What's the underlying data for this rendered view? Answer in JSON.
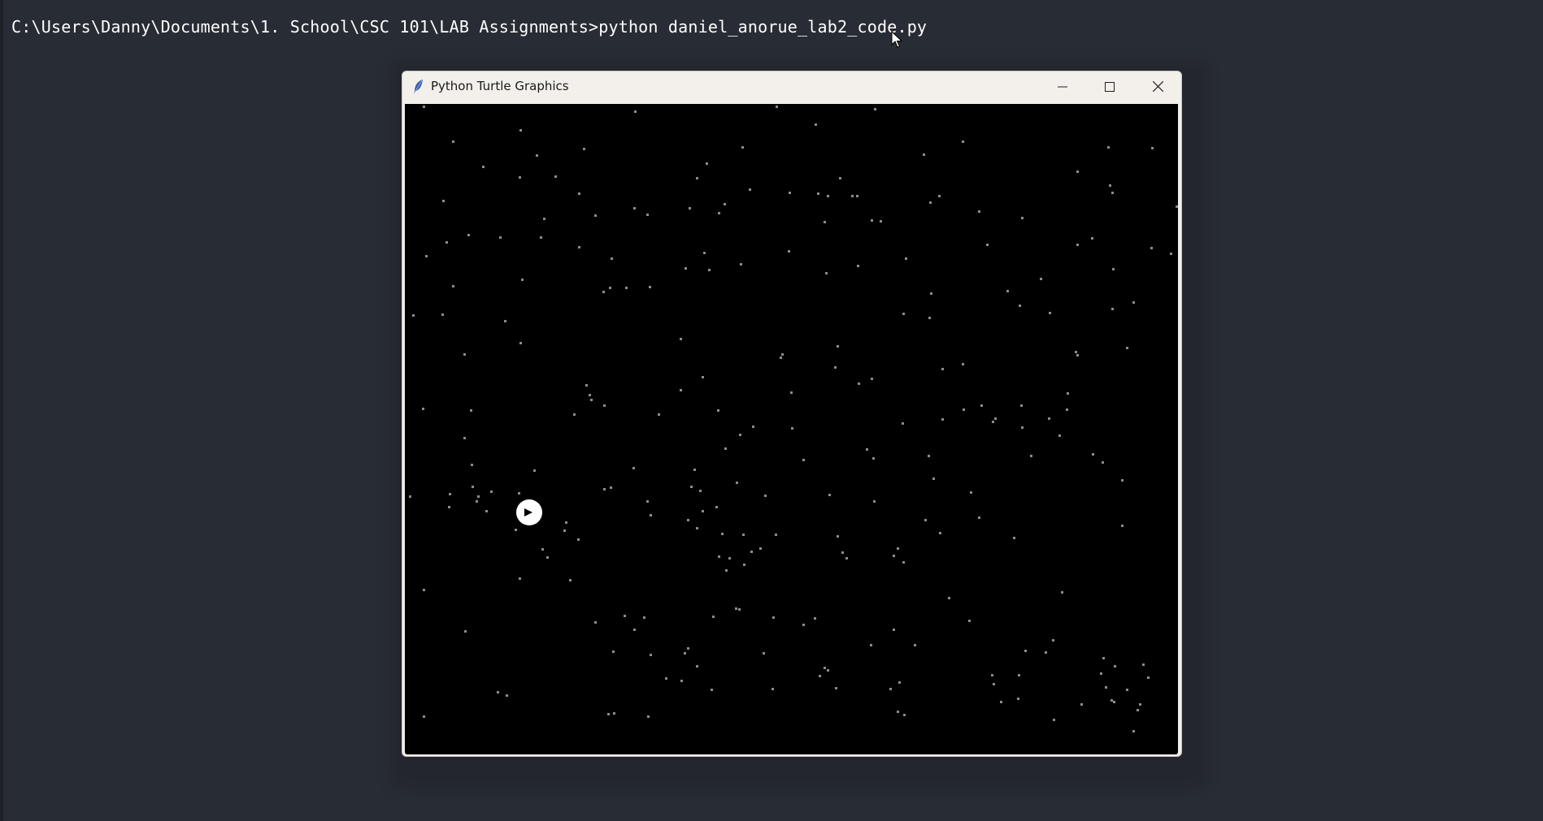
{
  "terminal": {
    "command_line": "C:\\Users\\Danny\\Documents\\1. School\\CSC 101\\LAB Assignments>python daniel_anorue_lab2_code.py"
  },
  "window": {
    "title": "Python Turtle Graphics",
    "controls": [
      "minimize-icon",
      "maximize-icon",
      "close-icon"
    ]
  },
  "canvas": {
    "background": "#000000",
    "star_color": "#8c8c8c",
    "turtle_color": "#ffffff",
    "turtle_heading": "east"
  }
}
